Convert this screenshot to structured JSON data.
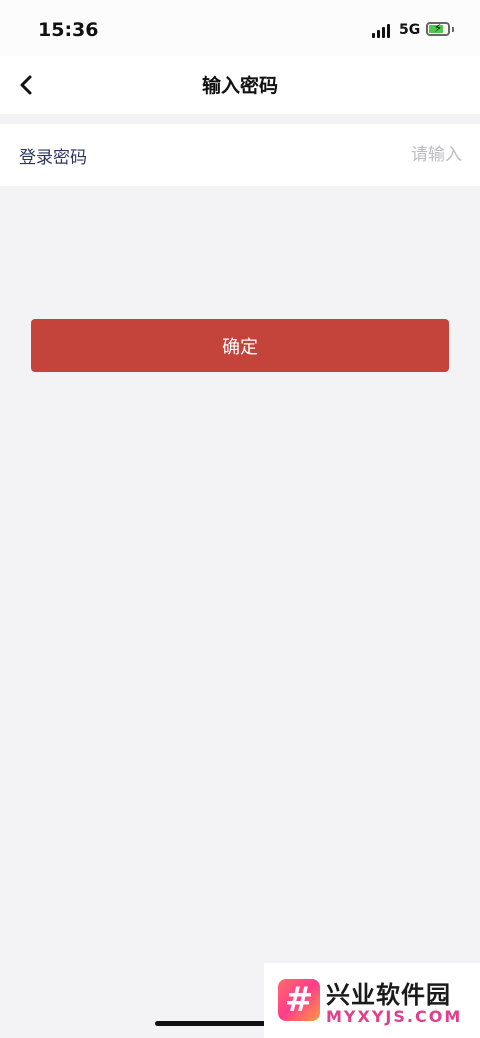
{
  "status_bar": {
    "time": "15:36",
    "network": "5G",
    "battery_level": 0.8,
    "battery_color": "#4cc94a"
  },
  "nav": {
    "title": "输入密码",
    "back_icon": "chevron-left-icon"
  },
  "form": {
    "password_label": "登录密码",
    "password_placeholder": "请输入",
    "password_value": ""
  },
  "confirm_button": {
    "label": "确定",
    "color": "#c4433a"
  },
  "watermark": {
    "logo_glyph": "#",
    "name": "兴业软件园",
    "domain": "MYXYJS.COM"
  }
}
